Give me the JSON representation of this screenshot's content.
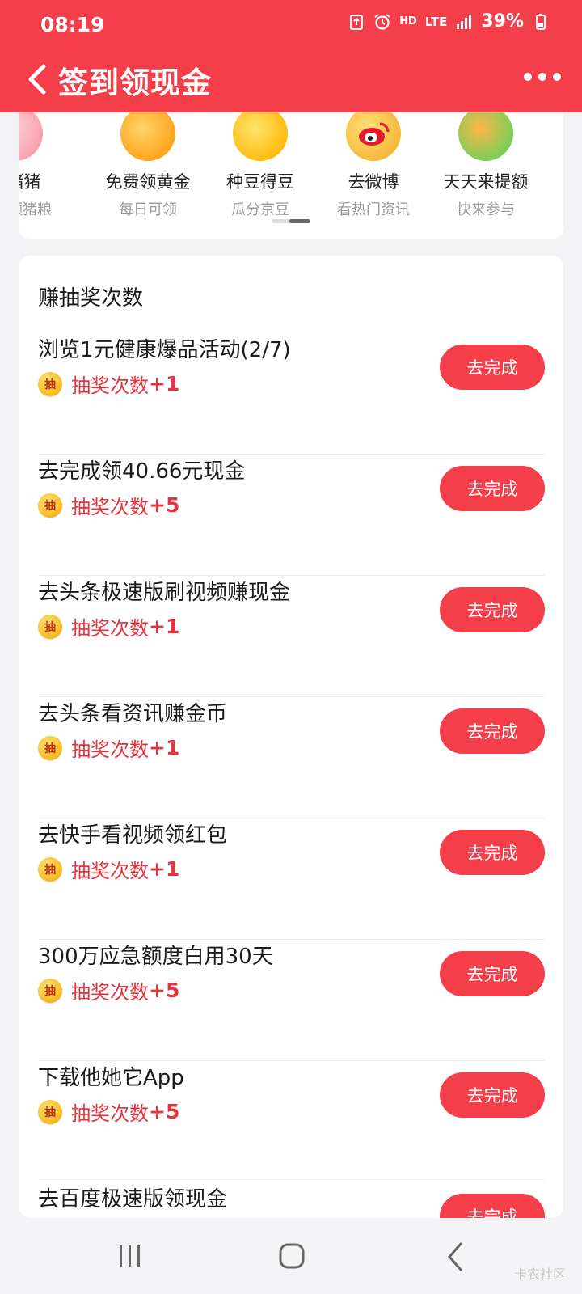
{
  "status": {
    "time": "08:19",
    "network": "HD",
    "lte": "LTE",
    "battery": "39%"
  },
  "header": {
    "title": "签到领现金"
  },
  "shortcuts": [
    {
      "name": "养猪猪",
      "sub": "天天领猪粮",
      "icon": "pig-icon",
      "color": "#f9a3b1"
    },
    {
      "name": "免费领黄金",
      "sub": "每日可领",
      "icon": "gold-icon",
      "color": "#ffb12b"
    },
    {
      "name": "种豆得豆",
      "sub": "瓜分京豆",
      "icon": "bean-icon",
      "color": "#ffc21a"
    },
    {
      "name": "去微博",
      "sub": "看热门资讯",
      "icon": "weibo-icon",
      "color": "#f5c443"
    },
    {
      "name": "天天来提额",
      "sub": "快来参与",
      "icon": "bird-icon",
      "color": "#7bcf56"
    }
  ],
  "tasks_section": {
    "title": "赚抽奖次数",
    "coin_label": "抽",
    "reward_label": "抽奖次数",
    "button_label": "去完成",
    "items": [
      {
        "title": "浏览1元健康爆品活动(2/7)",
        "reward": "+1"
      },
      {
        "title": "去完成领40.66元现金",
        "reward": "+5"
      },
      {
        "title": "去头条极速版刷视频赚现金",
        "reward": "+1"
      },
      {
        "title": "去头条看资讯赚金币",
        "reward": "+1"
      },
      {
        "title": "去快手看视频领红包",
        "reward": "+1"
      },
      {
        "title": "300万应急额度白用30天",
        "reward": "+5"
      },
      {
        "title": "下载他她它App",
        "reward": "+5"
      },
      {
        "title": "去百度极速版领现金",
        "reward": ""
      }
    ]
  },
  "watermark": "卡农社区",
  "colors": {
    "brand": "#f43e4a",
    "reward_text": "#e3343f"
  }
}
